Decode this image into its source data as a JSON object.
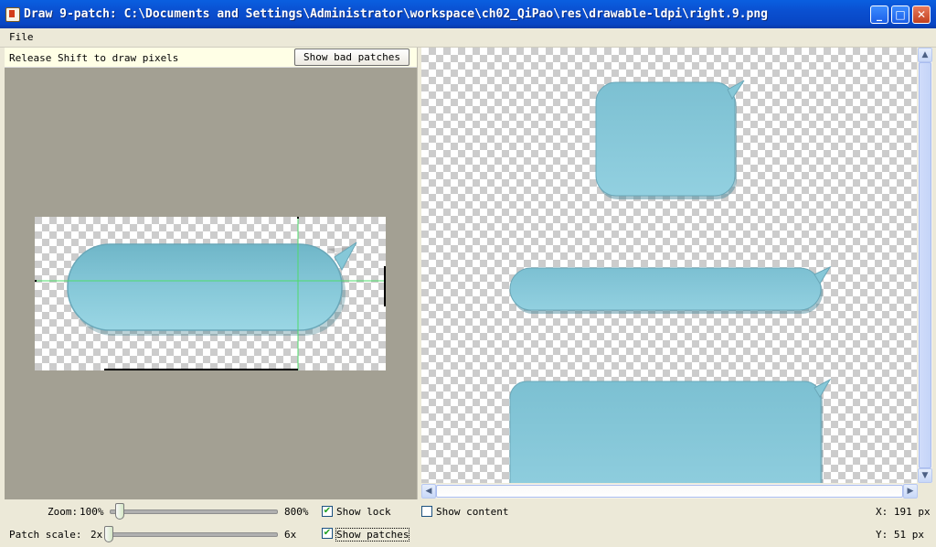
{
  "window": {
    "title": "Draw 9-patch: C:\\Documents and Settings\\Administrator\\workspace\\ch02_QiPao\\res\\drawable-ldpi\\right.9.png",
    "minimize_label": "_",
    "maximize_label": "□",
    "close_label": "✕"
  },
  "menu": {
    "file": "File"
  },
  "editor": {
    "hint": "Release Shift to draw pixels",
    "bad_patches_button": "Show bad patches"
  },
  "controls": {
    "zoom_label": "Zoom:",
    "zoom_min": "100%",
    "zoom_max": "800%",
    "zoom_value_percent": 100,
    "patch_scale_label": "Patch scale:",
    "patch_scale_min": "2x",
    "patch_scale_max": "6x",
    "patch_scale_value": 2,
    "show_lock": {
      "label": "Show lock",
      "checked": true
    },
    "show_patches": {
      "label": "Show patches",
      "checked": true
    },
    "show_content": {
      "label": "Show content",
      "checked": false
    },
    "x_readout": "X:  191 px",
    "y_readout": "Y:   51 px"
  },
  "colors": {
    "bubble": "#86c8d8",
    "bubble_shadow": "#5b9cae",
    "patch_guide": "#4ddb6a",
    "checker": "#cccccc",
    "editor_bg": "#a3a093"
  }
}
